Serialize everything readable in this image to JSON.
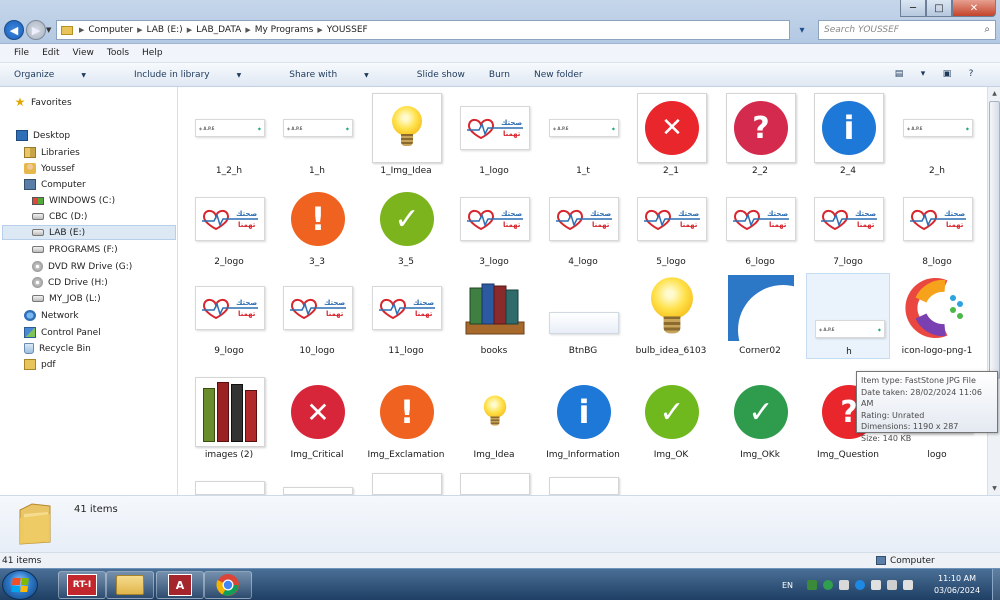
{
  "window": {
    "minimize": "─",
    "maximize": "□",
    "close": "✕"
  },
  "address": {
    "breadcrumbs": [
      "Computer",
      "LAB (E:)",
      "LAB_DATA",
      "My Programs",
      "YOUSSEF"
    ],
    "search_placeholder": "Search YOUSSEF"
  },
  "menu": [
    "File",
    "Edit",
    "View",
    "Tools",
    "Help"
  ],
  "toolbar": {
    "organize": "Organize",
    "include": "Include in library",
    "share": "Share with",
    "slideshow": "Slide show",
    "burn": "Burn",
    "newfolder": "New folder"
  },
  "nav": {
    "favorites": "Favorites",
    "desktop": "Desktop",
    "libraries": "Libraries",
    "user": "Youssef",
    "computer": "Computer",
    "drives": [
      "WINDOWS (C:)",
      "CBC (D:)",
      "LAB (E:)",
      "PROGRAMS (F:)",
      "DVD RW Drive (G:)",
      "CD Drive (H:)",
      "MY_JOB (L:)"
    ],
    "network": "Network",
    "control_panel": "Control Panel",
    "recycle_bin": "Recycle Bin",
    "pdf": "pdf"
  },
  "files": [
    [
      "1_2_h",
      "1_h",
      "1_Img_Idea",
      "1_logo",
      "1_t",
      "2_1",
      "2_2",
      "2_4",
      "2_h"
    ],
    [
      "2_logo",
      "3_3",
      "3_5",
      "3_logo",
      "4_logo",
      "5_logo",
      "6_logo",
      "7_logo",
      "8_logo"
    ],
    [
      "9_logo",
      "10_logo",
      "11_logo",
      "books",
      "BtnBG",
      "bulb_idea_6103",
      "Corner02",
      "h",
      "icon-logo-png-1"
    ],
    [
      "images (2)",
      "Img_Critical",
      "Img_Exclamation",
      "Img_Idea",
      "Img_Information",
      "Img_OK",
      "Img_OKk",
      "Img_Question",
      "logo"
    ]
  ],
  "tooltip": [
    "Item type: FastStone JPG File",
    "Date taken: 28/02/2024 11:06 AM",
    "Rating: Unrated",
    "Dimensions: 1190 x 287",
    "Size: 140 KB"
  ],
  "details": {
    "count": "41 items"
  },
  "status": {
    "left": "41 items",
    "right": "Computer"
  },
  "taskbar": {
    "lang": "EN",
    "time": "11:10 AM",
    "date": "03/06/2024",
    "app1_label": "RT-I",
    "app3_label": "A"
  },
  "logo_text": "صحتك تهمنا",
  "strip_text": "A.P.E"
}
